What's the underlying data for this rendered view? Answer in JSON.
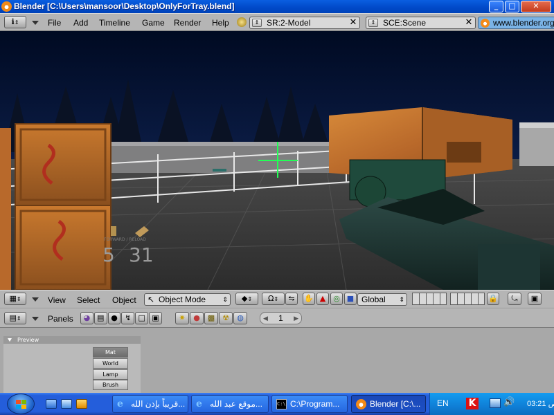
{
  "window": {
    "title": "Blender [C:\\Users\\mansoor\\Desktop\\OnlyForTray.blend]",
    "buttons": {
      "minimize": "_",
      "maximize": "□",
      "close": "✕"
    }
  },
  "topmenu": {
    "menus": [
      "File",
      "Add",
      "Timeline",
      "Game",
      "Render",
      "Help"
    ],
    "screen_field": "SR:2-Model",
    "scene_field": "SCE:Scene",
    "link_text": "www.blender.org"
  },
  "viewport": {
    "hud_ammo": "5",
    "hud_total": "31",
    "hud_caption": "FORWARD / RELOAD"
  },
  "view_header": {
    "menus": [
      "View",
      "Select",
      "Object"
    ],
    "mode": "Object Mode",
    "orientation": "Global"
  },
  "buttons_header": {
    "panels_label": "Panels",
    "frame_value": "1"
  },
  "preview_panel": {
    "title": "Preview",
    "buttons": [
      "Mat",
      "World",
      "Lamp",
      "Brush"
    ],
    "active": "Mat"
  },
  "taskbar": {
    "tasks": [
      {
        "label": "قريباً بإذن الله...",
        "icon": "ie-icon"
      },
      {
        "label": "موقع عبد الله...",
        "icon": "ie-icon"
      },
      {
        "label": "C:\\Program...",
        "icon": "cmd-icon"
      },
      {
        "label": "Blender [C:\\...",
        "icon": "blender-icon"
      }
    ],
    "active_task": "Blender [C:\\...",
    "language": "EN",
    "clock": "03:21 ص"
  },
  "colors": {
    "xp_blue": "#245edb",
    "blender_header": "#b5b5b5",
    "crosshair": "#22ff55"
  }
}
